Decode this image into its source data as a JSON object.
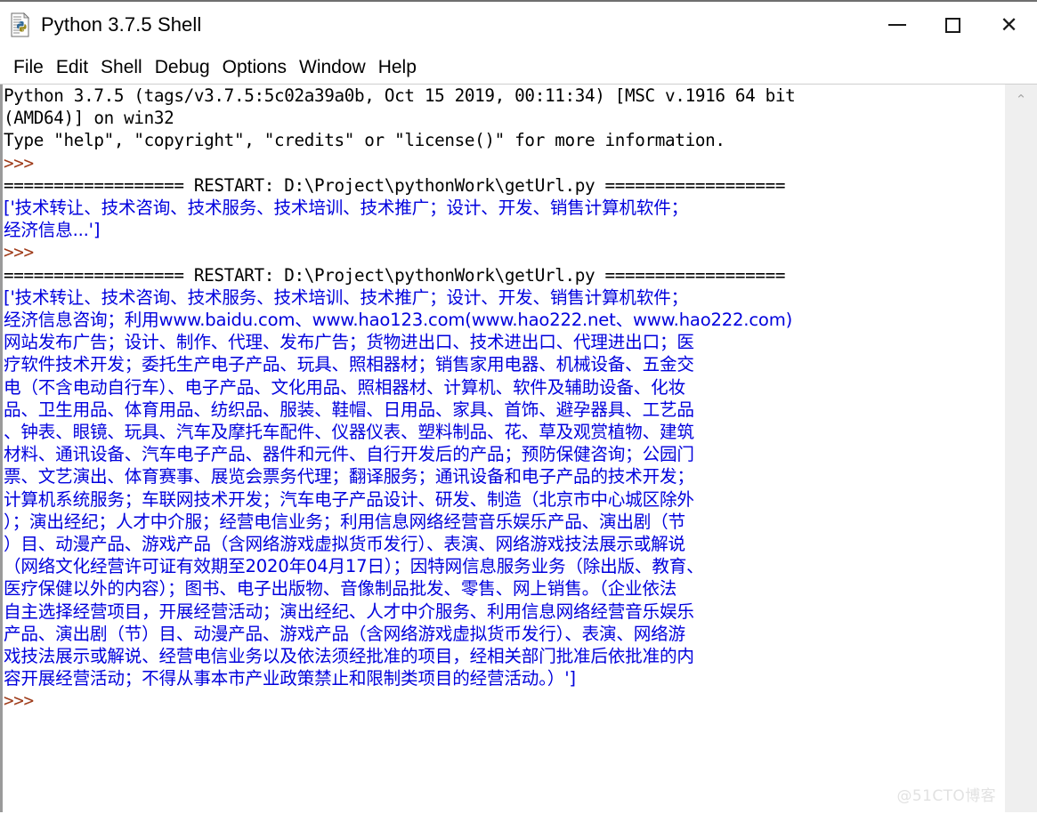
{
  "window": {
    "title": "Python 3.7.5 Shell",
    "icon": "python-file-icon",
    "controls": {
      "minimize": "minimize-icon",
      "maximize": "maximize-icon",
      "close": "✕"
    }
  },
  "menubar": {
    "items": [
      {
        "label": "File"
      },
      {
        "label": "Edit"
      },
      {
        "label": "Shell"
      },
      {
        "label": "Debug"
      },
      {
        "label": "Options"
      },
      {
        "label": "Window"
      },
      {
        "label": "Help"
      }
    ]
  },
  "scrollbar": {
    "up_arrow": "⌃",
    "name": "vertical-scrollbar"
  },
  "watermark": {
    "text": "@51CTO博客"
  },
  "colors": {
    "prompt": "#9e3a18",
    "output": "#0000dd",
    "text": "#000000",
    "background": "#ffffff",
    "scrollbar_track": "#efefef"
  },
  "shell": {
    "lines": [
      {
        "cls": "c-black",
        "cjk": false,
        "text": "Python 3.7.5 (tags/v3.7.5:5c02a39a0b, Oct 15 2019, 00:11:34) [MSC v.1916 64 bit"
      },
      {
        "cls": "c-black",
        "cjk": false,
        "text": "(AMD64)] on win32"
      },
      {
        "cls": "c-black",
        "cjk": false,
        "text": "Type \"help\", \"copyright\", \"credits\" or \"license()\" for more information."
      },
      {
        "cls": "c-prompt",
        "cjk": false,
        "text": ">>> "
      },
      {
        "cls": "c-black",
        "cjk": false,
        "text": "================== RESTART: D:\\Project\\pythonWork\\getUrl.py =================="
      },
      {
        "cls": "c-blue",
        "cjk": true,
        "text": "['技术转让、技术咨询、技术服务、技术培训、技术推广；设计、开发、销售计算机软件；"
      },
      {
        "cls": "c-blue",
        "cjk": true,
        "text": "经济信息...']"
      },
      {
        "cls": "c-prompt",
        "cjk": false,
        "text": ">>> "
      },
      {
        "cls": "c-black",
        "cjk": false,
        "text": "================== RESTART: D:\\Project\\pythonWork\\getUrl.py =================="
      },
      {
        "cls": "c-blue",
        "cjk": true,
        "text": "['技术转让、技术咨询、技术服务、技术培训、技术推广；设计、开发、销售计算机软件；"
      },
      {
        "cls": "c-blue",
        "cjk": true,
        "text": "经济信息咨询；利用www.baidu.com、www.hao123.com(www.hao222.net、www.hao222.com)"
      },
      {
        "cls": "c-blue",
        "cjk": true,
        "text": "网站发布广告；设计、制作、代理、发布广告；货物进出口、技术进出口、代理进出口；医"
      },
      {
        "cls": "c-blue",
        "cjk": true,
        "text": "疗软件技术开发；委托生产电子产品、玩具、照相器材；销售家用电器、机械设备、五金交"
      },
      {
        "cls": "c-blue",
        "cjk": true,
        "text": "电（不含电动自行车）、电子产品、文化用品、照相器材、计算机、软件及辅助设备、化妆"
      },
      {
        "cls": "c-blue",
        "cjk": true,
        "text": "品、卫生用品、体育用品、纺织品、服装、鞋帽、日用品、家具、首饰、避孕器具、工艺品"
      },
      {
        "cls": "c-blue",
        "cjk": true,
        "text": "、钟表、眼镜、玩具、汽车及摩托车配件、仪器仪表、塑料制品、花、草及观赏植物、建筑"
      },
      {
        "cls": "c-blue",
        "cjk": true,
        "text": "材料、通讯设备、汽车电子产品、器件和元件、自行开发后的产品；预防保健咨询；公园门"
      },
      {
        "cls": "c-blue",
        "cjk": true,
        "text": "票、文艺演出、体育赛事、展览会票务代理；翻译服务；通讯设备和电子产品的技术开发；"
      },
      {
        "cls": "c-blue",
        "cjk": true,
        "text": "计算机系统服务；车联网技术开发；汽车电子产品设计、研发、制造（北京市中心城区除外"
      },
      {
        "cls": "c-blue",
        "cjk": true,
        "text": "）；演出经纪；人才中介服；经营电信业务；利用信息网络经营音乐娱乐产品、演出剧（节"
      },
      {
        "cls": "c-blue",
        "cjk": true,
        "text": "）目、动漫产品、游戏产品（含网络游戏虚拟货币发行）、表演、网络游戏技法展示或解说"
      },
      {
        "cls": "c-blue",
        "cjk": true,
        "text": "（网络文化经营许可证有效期至2020年04月17日）；因特网信息服务业务（除出版、教育、"
      },
      {
        "cls": "c-blue",
        "cjk": true,
        "text": "医疗保健以外的内容）；图书、电子出版物、音像制品批发、零售、网上销售。（企业依法"
      },
      {
        "cls": "c-blue",
        "cjk": true,
        "text": "自主选择经营项目，开展经营活动；演出经纪、人才中介服务、利用信息网络经营音乐娱乐"
      },
      {
        "cls": "c-blue",
        "cjk": true,
        "text": "产品、演出剧（节）目、动漫产品、游戏产品（含网络游戏虚拟货币发行）、表演、网络游"
      },
      {
        "cls": "c-blue",
        "cjk": true,
        "text": "戏技法展示或解说、经营电信业务以及依法须经批准的项目，经相关部门批准后依批准的内"
      },
      {
        "cls": "c-blue",
        "cjk": true,
        "text": "容开展经营活动；不得从事本市产业政策禁止和限制类项目的经营活动。）']"
      },
      {
        "cls": "c-prompt",
        "cjk": false,
        "text": ">>> "
      }
    ]
  }
}
